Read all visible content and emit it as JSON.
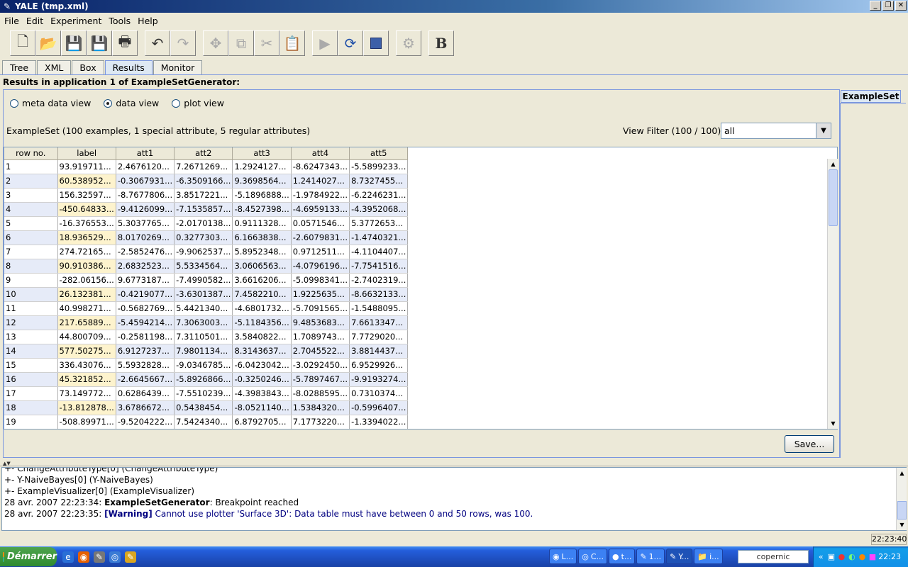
{
  "window": {
    "title": "YALE (tmp.xml)"
  },
  "menu": [
    "File",
    "Edit",
    "Experiment",
    "Tools",
    "Help"
  ],
  "tabs": [
    "Tree",
    "XML",
    "Box",
    "Results",
    "Monitor"
  ],
  "results_title": "Results in application 1 of ExampleSetGenerator:",
  "side_tab": "ExampleSet",
  "radios": [
    "meta data view",
    "data view",
    "plot view"
  ],
  "summary": "ExampleSet (100 examples, 1 special attribute, 5 regular attributes)",
  "view_filter": {
    "label": "View Filter  (100 / 100):",
    "value": "all"
  },
  "table": {
    "headers": [
      "row no.",
      "label",
      "att1",
      "att2",
      "att3",
      "att4",
      "att5"
    ],
    "rows": [
      [
        "1",
        "93.919711...",
        "2.4676120...",
        "7.2671269...",
        "1.2924127...",
        "-8.6247343...",
        "-5.5899233..."
      ],
      [
        "2",
        "60.538952...",
        "-0.3067931...",
        "-6.3509166...",
        "9.3698564...",
        "1.2414027...",
        "8.7327455..."
      ],
      [
        "3",
        "156.32597...",
        "-8.7677806...",
        "3.8517221...",
        "-5.1896888...",
        "-1.9784922...",
        "-6.2246231..."
      ],
      [
        "4",
        "-450.64833...",
        "-9.4126099...",
        "-7.1535857...",
        "-8.4527398...",
        "-4.6959133...",
        "-4.3952068..."
      ],
      [
        "5",
        "-16.376553...",
        "5.3037765...",
        "-2.0170138...",
        "0.9111328...",
        "0.0571546...",
        "5.3772653..."
      ],
      [
        "6",
        "18.936529...",
        "8.0170269...",
        "0.3277303...",
        "6.1663838...",
        "-2.6079831...",
        "-1.4740321..."
      ],
      [
        "7",
        "274.72165...",
        "-2.5852476...",
        "-9.9062537...",
        "5.8952348...",
        "0.9712511...",
        "-4.1104407..."
      ],
      [
        "8",
        "90.910386...",
        "2.6832523...",
        "5.5334564...",
        "3.0606563...",
        "-4.0796196...",
        "-7.7541516..."
      ],
      [
        "9",
        "-282.06156...",
        "9.6773187...",
        "-7.4990582...",
        "3.6616206...",
        "-5.0998341...",
        "-2.7402319..."
      ],
      [
        "10",
        "26.132381...",
        "-0.4219077...",
        "-3.6301387...",
        "7.4582210...",
        "1.9225635...",
        "-8.6632133..."
      ],
      [
        "11",
        "40.998271...",
        "-0.5682769...",
        "5.4421340...",
        "-4.6801732...",
        "-5.7091565...",
        "-1.5488095..."
      ],
      [
        "12",
        "217.65889...",
        "-5.4594214...",
        "7.3063003...",
        "-5.1184356...",
        "9.4853683...",
        "7.6613347..."
      ],
      [
        "13",
        "44.800709...",
        "-0.2581198...",
        "7.3110501...",
        "3.5840822...",
        "1.7089743...",
        "7.7729020..."
      ],
      [
        "14",
        "577.50275...",
        "6.9127237...",
        "7.9801134...",
        "8.3143637...",
        "2.7045522...",
        "3.8814437..."
      ],
      [
        "15",
        "336.43076...",
        "5.5932828...",
        "-9.0346785...",
        "-6.0423042...",
        "-3.0292450...",
        "6.9529926..."
      ],
      [
        "16",
        "45.321852...",
        "-2.6645667...",
        "-5.8926866...",
        "-0.3250246...",
        "-5.7897467...",
        "-9.9193274..."
      ],
      [
        "17",
        "73.149772...",
        "0.6286439...",
        "-7.5510239...",
        "-4.3983843...",
        "-8.0288595...",
        "0.7310374..."
      ],
      [
        "18",
        "-13.812878...",
        "3.6786672...",
        "0.5438454...",
        "-8.0521140...",
        "1.5384320...",
        "-0.5996407..."
      ],
      [
        "19",
        "-508.89971...",
        "-9.5204222...",
        "7.5424340...",
        "6.8792705...",
        "7.1773220...",
        "-1.3394022..."
      ]
    ]
  },
  "save_label": "Save...",
  "log": {
    "lines": [
      {
        "prefix": "",
        "bold": "",
        "text": "   +- ChangeAttributeType[0] (ChangeAttributeType)",
        "style": "plain"
      },
      {
        "prefix": "",
        "bold": "",
        "text": "   +- Y-NaiveBayes[0] (Y-NaiveBayes)",
        "style": "plain"
      },
      {
        "prefix": "",
        "bold": "",
        "text": "   +- ExampleVisualizer[0] (ExampleVisualizer)",
        "style": "plain"
      },
      {
        "prefix": "28 avr. 2007 22:23:34: ",
        "bold": "ExampleSetGenerator",
        "text": ": Breakpoint reached",
        "style": "bold"
      },
      {
        "prefix": "28 avr. 2007 22:23:35: ",
        "bold": "[Warning]",
        "text": " Cannot use plotter 'Surface 3D': Data table must have between 0 and 50 rows, was 100.",
        "style": "warn"
      }
    ]
  },
  "status_clock": "22:23:40",
  "taskbar": {
    "start": "Démarrer",
    "tasks": [
      "L...",
      "C...",
      "t...",
      "1...",
      "Y...",
      "i..."
    ],
    "search": "copernic",
    "time": "22:23"
  }
}
